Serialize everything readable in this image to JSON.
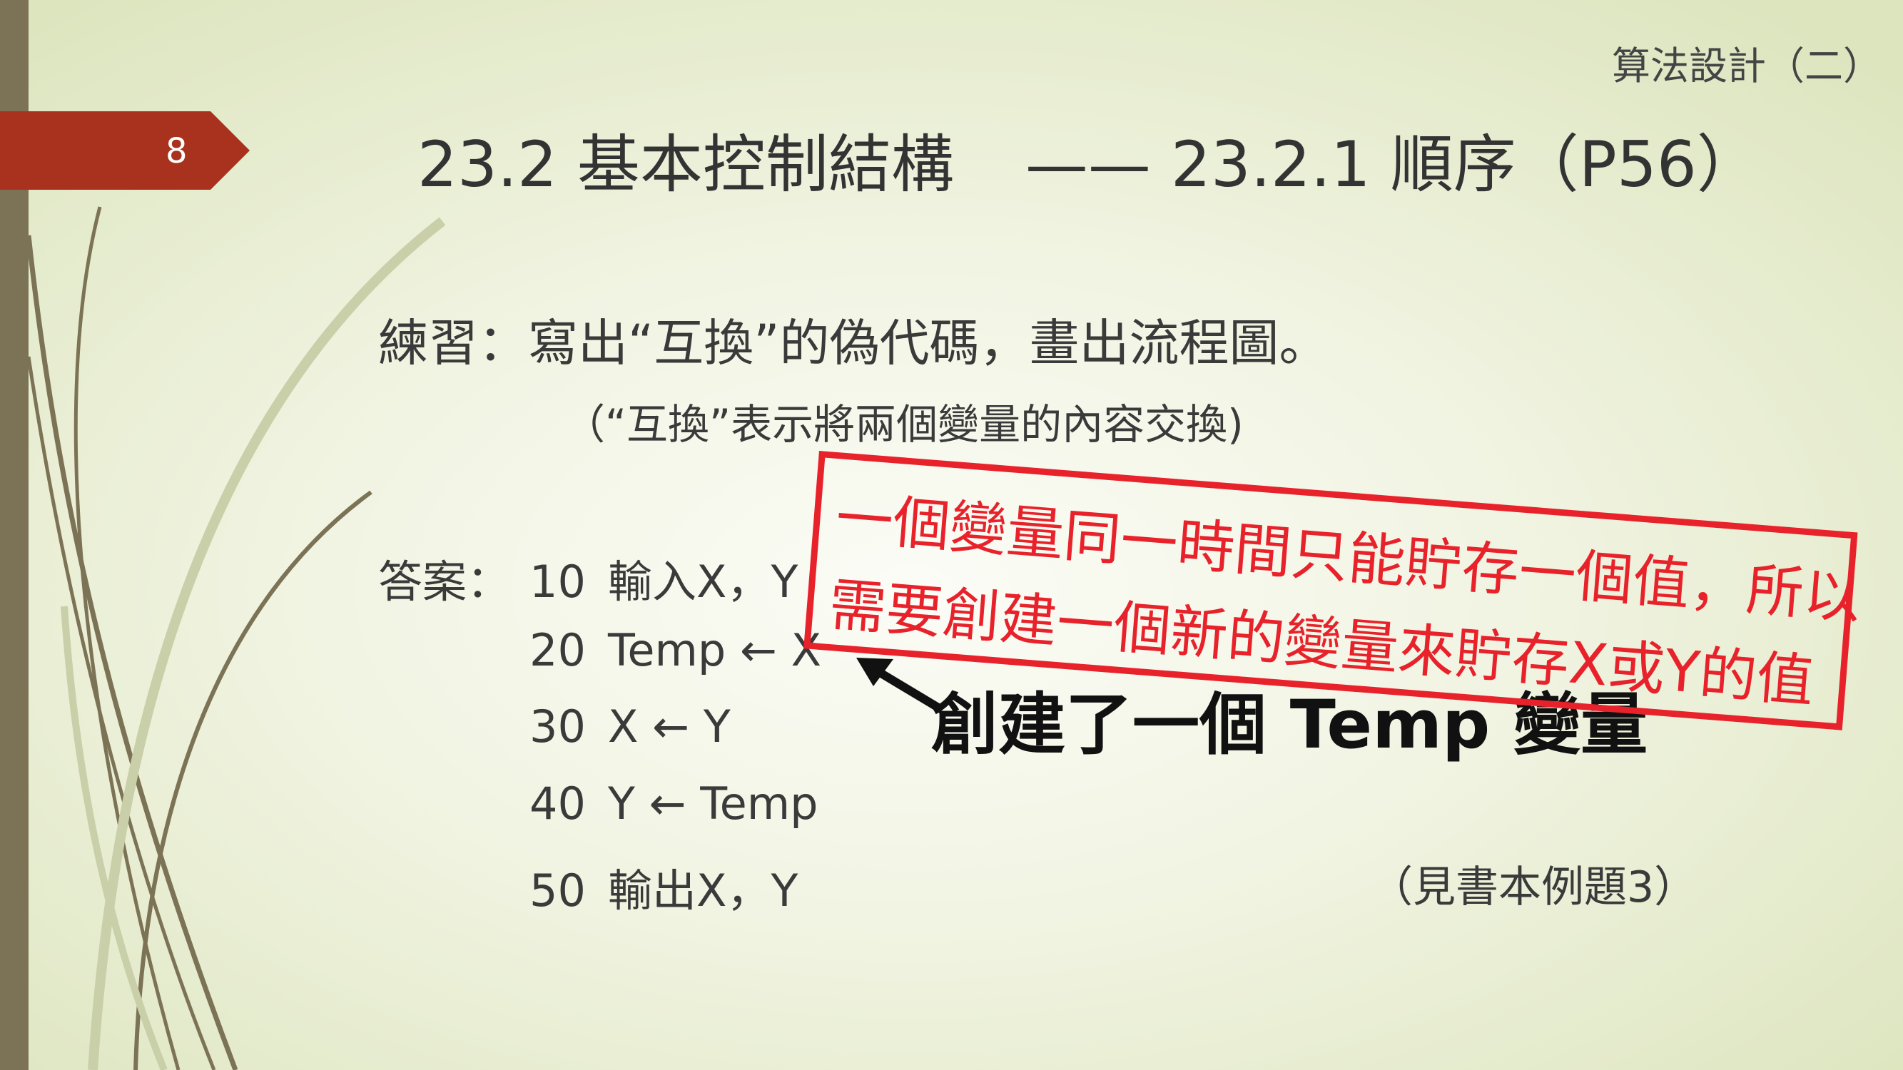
{
  "slide": {
    "number": "8",
    "header": "算法設計（二）",
    "title_main": "23.2 基本控制結構",
    "title_sub": "—— 23.2.1 順序（P56）"
  },
  "content": {
    "exercise": "練習：寫出“互換”的偽代碼，畫出流程圖。",
    "note": "（“互換”表示將兩個變量的內容交換)",
    "answer_label": "答案：",
    "code_lines": [
      {
        "num": "10",
        "text": "輸入X，Y"
      },
      {
        "num": "20",
        "text": "Temp ← X"
      },
      {
        "num": "30",
        "text": "X ← Y"
      },
      {
        "num": "40",
        "text": "Y ← Temp"
      },
      {
        "num": "50",
        "text": "輸出X，Y"
      }
    ],
    "reference": "（見書本例題3）"
  },
  "annotation": {
    "callout": "創建了一個 Temp 變量",
    "stamp_line1": "一個變量同一時間只能貯存一個值，所以",
    "stamp_line2": "需要創建一個新的變量來貯存X或Y的值"
  },
  "colors": {
    "accent": "#a8321d",
    "stamp": "#e8222b",
    "left_bar": "#7c7356"
  }
}
